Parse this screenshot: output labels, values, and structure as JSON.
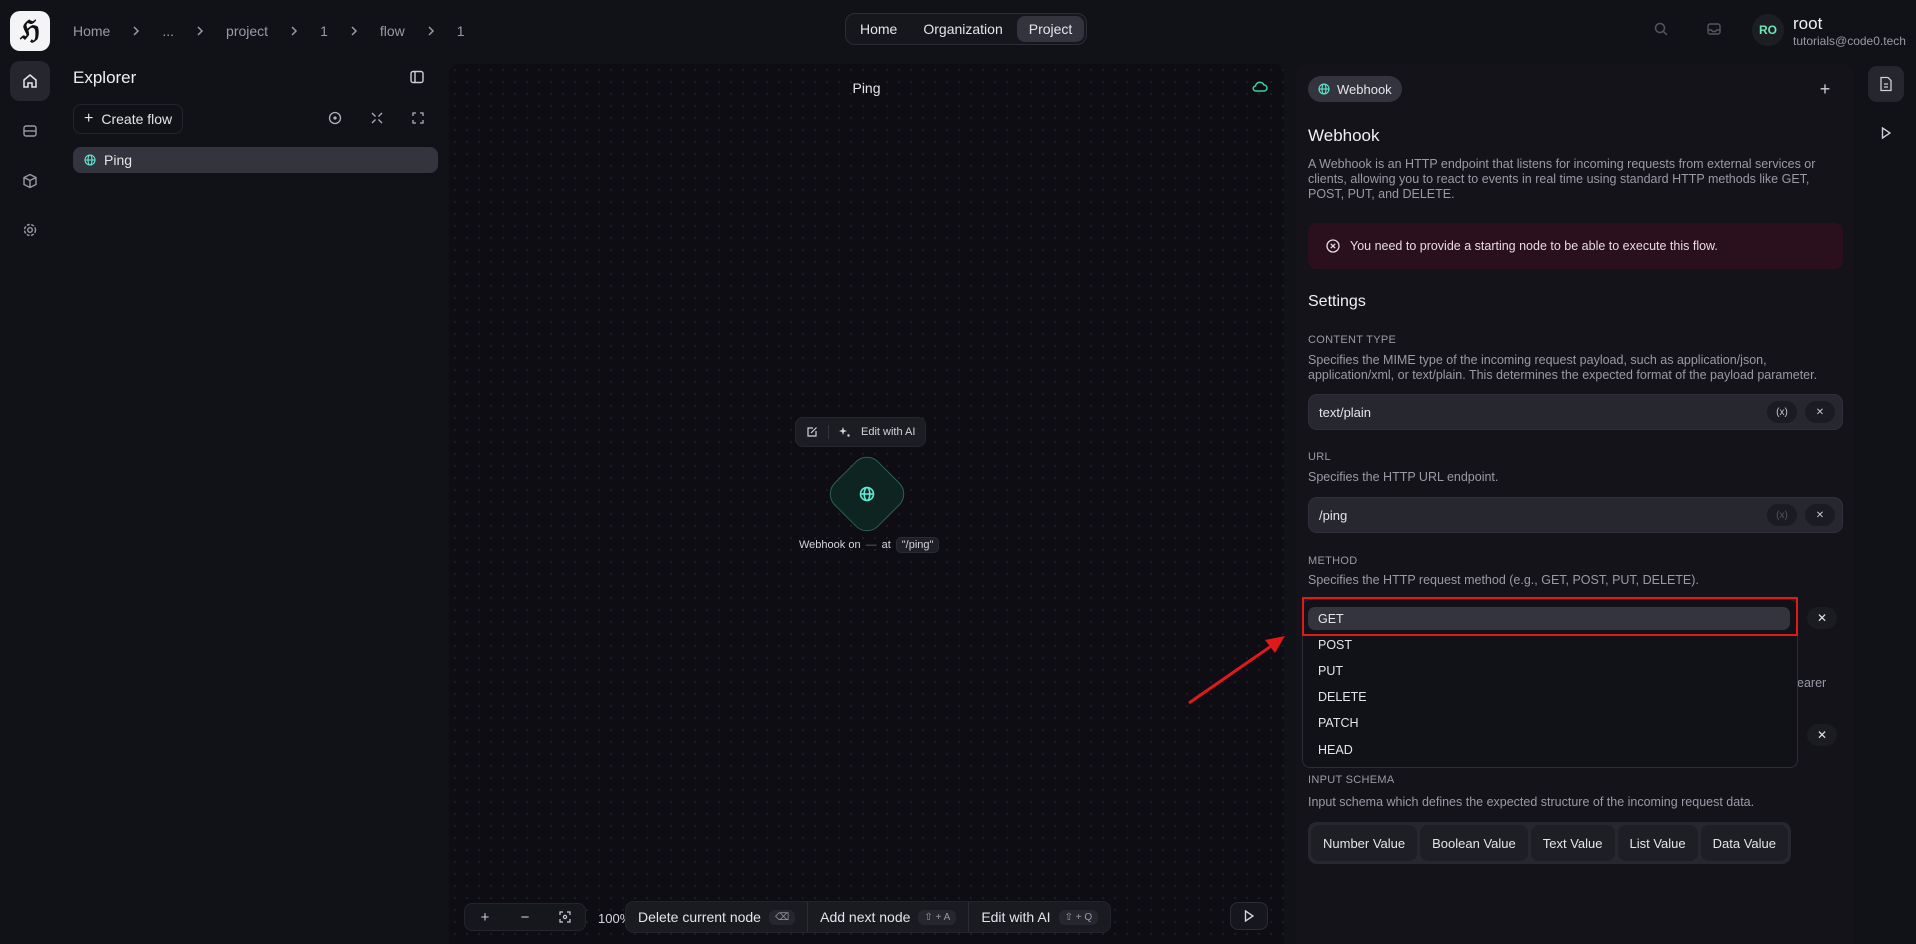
{
  "header": {
    "breadcrumbs": [
      "Home",
      "...",
      "project",
      "1",
      "flow",
      "1"
    ],
    "nav_tabs": [
      "Home",
      "Organization",
      "Project"
    ],
    "active_tab": "Project",
    "user": {
      "initials": "RO",
      "name": "root",
      "email": "tutorials@code0.tech"
    }
  },
  "explorer": {
    "title": "Explorer",
    "create_label": "Create flow",
    "flows": [
      "Ping"
    ]
  },
  "canvas": {
    "title": "Ping",
    "node_toolbar": {
      "edit_ai": "Edit with AI"
    },
    "node_caption": {
      "prefix": "Webhook on",
      "dash": "—",
      "at": "at",
      "path": "\"/ping\""
    },
    "zoom": "100%",
    "actions": [
      {
        "label": "Delete current node",
        "kbd": "⌫"
      },
      {
        "label": "Add next node",
        "kbd": "⇧ + A"
      },
      {
        "label": "Edit with AI",
        "kbd": "⇧ + Q"
      }
    ]
  },
  "panel": {
    "badge": "Webhook",
    "title": "Webhook",
    "description": "A Webhook is an HTTP endpoint that listens for incoming requests from external services or clients, allowing you to react to events in real time using standard HTTP methods like GET, POST, PUT, and DELETE.",
    "alert": "You need to provide a starting node to be able to execute this flow.",
    "settings_title": "Settings",
    "content_type": {
      "label": "CONTENT TYPE",
      "description": "Specifies the MIME type of the incoming request payload, such as application/json, application/xml, or text/plain. This determines the expected format of the payload parameter.",
      "value": "text/plain"
    },
    "url": {
      "label": "URL",
      "description": "Specifies the HTTP URL endpoint.",
      "value": "/ping"
    },
    "method": {
      "label": "METHOD",
      "description": "Specifies the HTTP request method (e.g., GET, POST, PUT, DELETE).",
      "options": [
        "GET",
        "POST",
        "PUT",
        "DELETE",
        "PATCH",
        "HEAD"
      ],
      "selected": "GET"
    },
    "hidden_desc_fragment": "earer",
    "input_schema": {
      "label": "INPUT SCHEMA",
      "description": "Input schema which defines the expected structure of the incoming request data.",
      "types": [
        "Number Value",
        "Boolean Value",
        "Text Value",
        "List Value",
        "Data Value"
      ]
    }
  },
  "colors": {
    "accent_green": "#34d399",
    "alert_bg": "#2a0f1c",
    "annotation_red": "#e01919"
  }
}
